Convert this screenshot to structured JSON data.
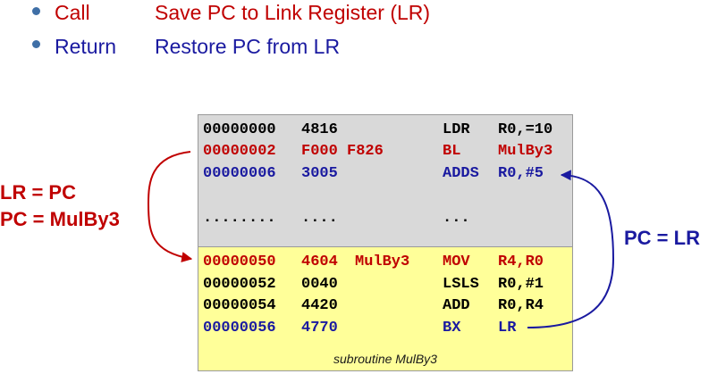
{
  "colors": {
    "red": "#c00000",
    "blue": "#1a1aa0",
    "black": "#000000",
    "bullet": "#3f6fa6",
    "panel_gray": "#d9d9d9",
    "panel_yellow": "#ffff99"
  },
  "bullets": [
    {
      "term": "Call",
      "description": "Save PC to Link Register (LR)",
      "color": "#c00000"
    },
    {
      "term": "Return",
      "description": "Restore PC from LR",
      "color": "#1a1aa0"
    }
  ],
  "code_lines": [
    {
      "address": "00000000",
      "hex": "4816",
      "label": "",
      "mnemonic": "LDR",
      "operands": "R0,=10",
      "color": "#000000"
    },
    {
      "address": "00000002",
      "hex": "F000 F826",
      "label": "",
      "mnemonic": "BL",
      "operands": "MulBy3",
      "color": "#c00000"
    },
    {
      "address": "00000006",
      "hex": "3005",
      "label": "",
      "mnemonic": "ADDS",
      "operands": "R0,#5",
      "color": "#1a1aa0"
    },
    {
      "address": "",
      "hex": "",
      "label": "",
      "mnemonic": "",
      "operands": "",
      "color": "#000000"
    },
    {
      "address": "........",
      "hex": "....",
      "label": "",
      "mnemonic": "...",
      "operands": "",
      "color": "#000000"
    },
    {
      "address": "00000050",
      "hex": "4604",
      "label": "MulBy3",
      "mnemonic": "MOV",
      "operands": "R4,R0",
      "color": "#c00000"
    },
    {
      "address": "00000052",
      "hex": "0040",
      "label": "",
      "mnemonic": "LSLS",
      "operands": "R0,#1",
      "color": "#000000"
    },
    {
      "address": "00000054",
      "hex": "4420",
      "label": "",
      "mnemonic": "ADD",
      "operands": "R0,R4",
      "color": "#000000"
    },
    {
      "address": "00000056",
      "hex": "4770",
      "label": "",
      "mnemonic": "BX",
      "operands": "LR",
      "color": "#1a1aa0"
    }
  ],
  "subroutine_caption": "subroutine MulBy3",
  "call_annotation": {
    "line1": "LR = PC",
    "line2": "PC = MulBy3"
  },
  "return_annotation": "PC = LR"
}
